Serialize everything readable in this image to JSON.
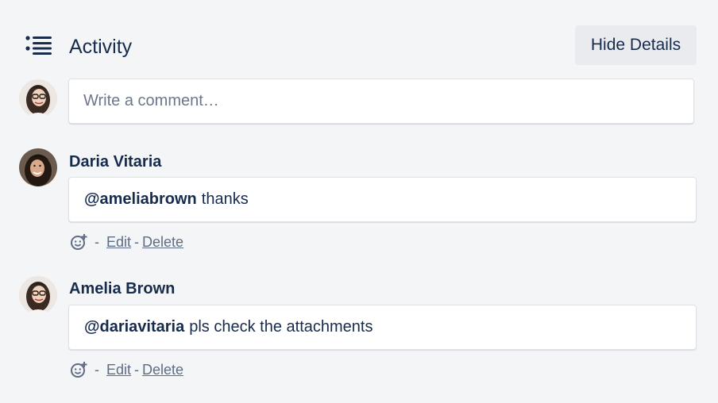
{
  "header": {
    "title": "Activity",
    "hide_details_label": "Hide Details"
  },
  "new_comment": {
    "placeholder": "Write a comment…"
  },
  "comments": [
    {
      "author": "Daria Vitaria",
      "mention": "@ameliabrown",
      "text": "thanks",
      "separator": "-",
      "edit_label": "Edit",
      "delete_label": "Delete"
    },
    {
      "author": "Amelia Brown",
      "mention": "@dariavitaria",
      "text": "pls check the attachments",
      "separator": "-",
      "edit_label": "Edit",
      "delete_label": "Delete"
    }
  ],
  "icons": {
    "activity": "list-icon",
    "reaction": "add-reaction-icon"
  },
  "colors": {
    "background": "#f4f5f7",
    "text": "#172b4d",
    "muted": "#5e6c84",
    "button": "#e9ebee"
  }
}
